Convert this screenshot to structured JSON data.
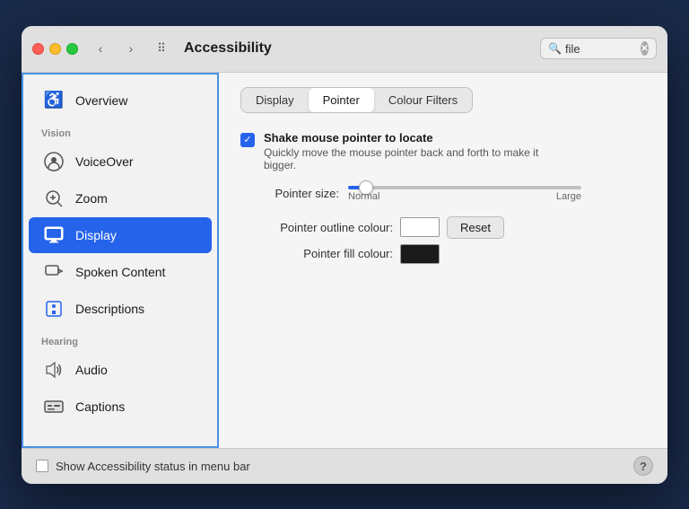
{
  "window": {
    "title": "Accessibility",
    "search_placeholder": "file"
  },
  "sidebar": {
    "top_item": {
      "label": "Overview",
      "icon": "👁"
    },
    "sections": [
      {
        "label": "Vision",
        "items": [
          {
            "id": "voiceover",
            "label": "VoiceOver",
            "icon": "⊙"
          },
          {
            "id": "zoom",
            "label": "Zoom",
            "icon": "⊡"
          },
          {
            "id": "display",
            "label": "Display",
            "icon": "🖥",
            "active": true
          },
          {
            "id": "spoken-content",
            "label": "Spoken Content",
            "icon": "💬"
          },
          {
            "id": "descriptions",
            "label": "Descriptions",
            "icon": "💬"
          }
        ]
      },
      {
        "label": "Hearing",
        "items": [
          {
            "id": "audio",
            "label": "Audio",
            "icon": "🔊"
          },
          {
            "id": "captions",
            "label": "Captions",
            "icon": "⬛"
          }
        ]
      }
    ]
  },
  "content": {
    "tabs": [
      {
        "id": "display",
        "label": "Display"
      },
      {
        "id": "pointer",
        "label": "Pointer",
        "active": true
      },
      {
        "id": "colour-filters",
        "label": "Colour Filters"
      }
    ],
    "shake_checkbox": {
      "checked": true,
      "title": "Shake mouse pointer to locate",
      "description": "Quickly move the mouse pointer back and forth to make it bigger."
    },
    "pointer_size": {
      "label": "Pointer size:",
      "min_label": "Normal",
      "max_label": "Large"
    },
    "pointer_outline": {
      "label": "Pointer outline colour:",
      "color": "white"
    },
    "pointer_fill": {
      "label": "Pointer fill colour:",
      "color": "black"
    },
    "reset_label": "Reset"
  },
  "bottombar": {
    "checkbox_label": "Show Accessibility status in menu bar",
    "help_label": "?"
  }
}
